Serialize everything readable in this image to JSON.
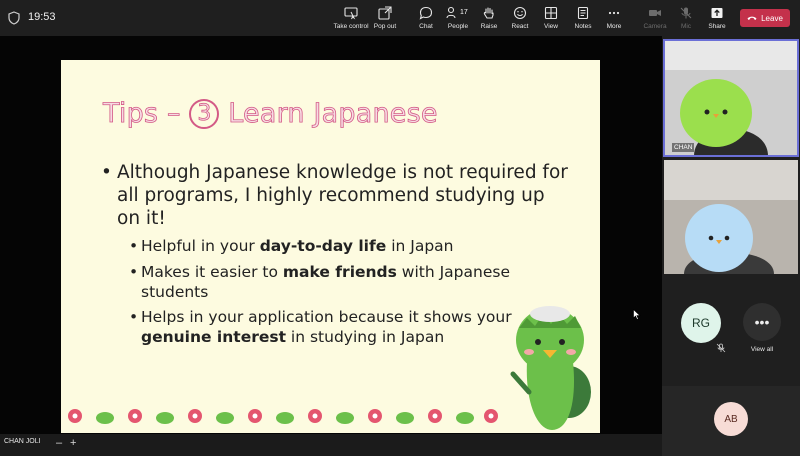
{
  "status_bar": {
    "time": "19:53"
  },
  "toolbar": {
    "take_control": "Take control",
    "pop_out": "Pop out",
    "chat": "Chat",
    "people": "People",
    "people_count": "17",
    "raise": "Raise",
    "react": "React",
    "view": "View",
    "notes": "Notes",
    "more": "More",
    "camera": "Camera",
    "mic": "Mic",
    "share": "Share",
    "leave": "Leave",
    "leave_color": "#c4314b"
  },
  "slide": {
    "title_prefix": "Tips –",
    "title_number": "3",
    "title_suffix": "Learn Japanese",
    "main_bullet": "Although Japanese knowledge is not required for all programs, I highly recommend studying up on it!",
    "sub_bullets": [
      {
        "before": "Helpful in your ",
        "bold": "day-to-day life",
        "after": " in Japan"
      },
      {
        "before": "Makes it easier to ",
        "bold": "make friends",
        "after": " with Japanese students"
      },
      {
        "before": "Helps in your application because it shows your ",
        "bold": "genuine interest",
        "after": " in studying in Japan"
      }
    ]
  },
  "presenter_bar": {
    "name": "CHAN JOLI",
    "zoom_out": "–",
    "zoom_in": "+"
  },
  "participants": {
    "tile1_name": "CHAN",
    "rg_initials": "RG",
    "view_all": "View all",
    "ab_initials": "AB"
  }
}
